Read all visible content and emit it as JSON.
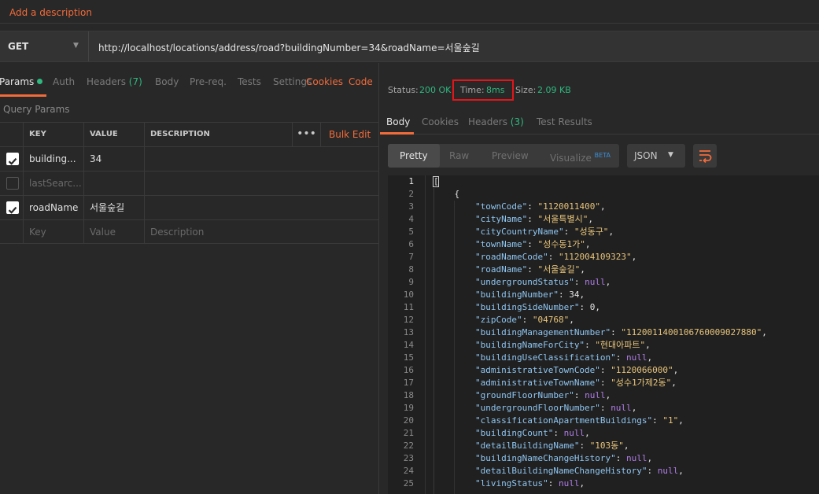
{
  "header": {
    "add_description": "Add a description"
  },
  "request": {
    "method": "GET",
    "url": "http://localhost/locations/address/road?buildingNumber=34&roadName=서울숲길"
  },
  "request_tabs": {
    "params": "Params",
    "auth": "Auth",
    "headers": "Headers",
    "headers_count": "(7)",
    "body": "Body",
    "prereq": "Pre-req.",
    "tests": "Tests",
    "settings": "Settings",
    "cookies": "Cookies",
    "code": "Code"
  },
  "query_params": {
    "title": "Query Params",
    "columns": {
      "key": "KEY",
      "value": "VALUE",
      "description": "DESCRIPTION"
    },
    "more": "•••",
    "bulk_edit": "Bulk Edit",
    "rows": [
      {
        "key": "building...",
        "value": "34",
        "description": "",
        "checked": true
      },
      {
        "key": "lastSearc...",
        "value": "",
        "description": "",
        "checked": false
      },
      {
        "key": "roadName",
        "value": "서울숲길",
        "description": "",
        "checked": true
      }
    ],
    "placeholders": {
      "key": "Key",
      "value": "Value",
      "description": "Description"
    }
  },
  "response": {
    "status_label": "Status:",
    "status_value": "200 OK",
    "time_label": "Time:",
    "time_value": "8ms",
    "size_label": "Size:",
    "size_value": "2.09 KB",
    "tabs": {
      "body": "Body",
      "cookies": "Cookies",
      "headers": "Headers",
      "headers_count": "(3)",
      "test_results": "Test Results"
    },
    "view_modes": {
      "pretty": "Pretty",
      "raw": "Raw",
      "preview": "Preview",
      "visualize": "Visualize",
      "beta": "BETA"
    },
    "format": "JSON",
    "code_lines": [
      "[",
      "    {",
      "        \"townCode\": \"1120011400\",",
      "        \"cityName\": \"서울특별시\",",
      "        \"cityCountryName\": \"성동구\",",
      "        \"townName\": \"성수동1가\",",
      "        \"roadNameCode\": \"112004109323\",",
      "        \"roadName\": \"서울숲길\",",
      "        \"undergroundStatus\": null,",
      "        \"buildingNumber\": 34,",
      "        \"buildingSideNumber\": 0,",
      "        \"zipCode\": \"04768\",",
      "        \"buildingManagementNumber\": \"1120011400106760009027880\",",
      "        \"buildingNameForCity\": \"현대아파트\",",
      "        \"buildingUseClassification\": null,",
      "        \"administrativeTownCode\": \"1120066000\",",
      "        \"administrativeTownName\": \"성수1가제2동\",",
      "        \"groundFloorNumber\": null,",
      "        \"undergroundFloorNumber\": null,",
      "        \"classificationApartmentBuildings\": \"1\",",
      "        \"buildingCount\": null,",
      "        \"detailBuildingName\": \"103동\",",
      "        \"buildingNameChangeHistory\": null,",
      "        \"detailBuildingNameChangeHistory\": null,",
      "        \"livingStatus\": null,"
    ]
  },
  "colors": {
    "accent": "#f26b3a",
    "success": "#2fb880",
    "highlight_box": "#e3151b",
    "json_key": "#8fc6f2",
    "json_string": "#e8c47a",
    "json_null": "#b07de8"
  }
}
